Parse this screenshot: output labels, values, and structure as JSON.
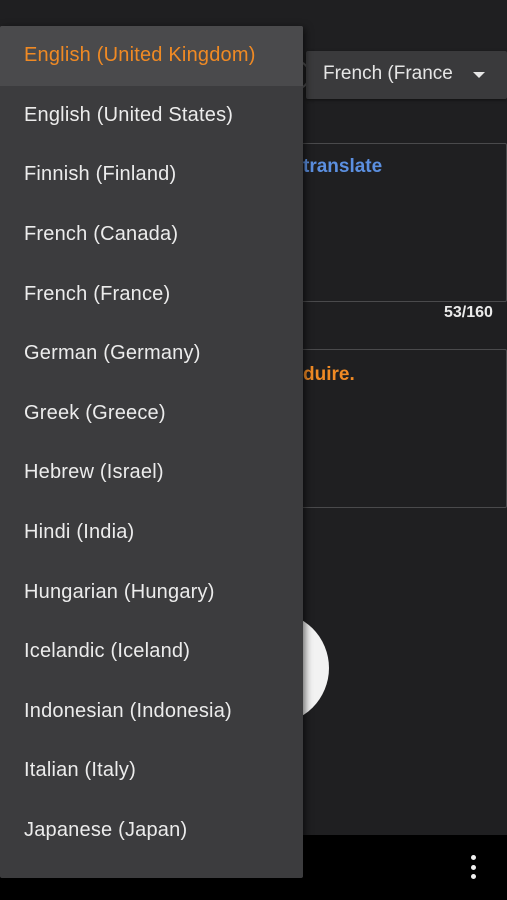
{
  "target_language": {
    "selected_label": "French (France)",
    "caret_icon": "caret-down-icon"
  },
  "input_box": {
    "text": "translate"
  },
  "output_box": {
    "text": "duire."
  },
  "char_count": "53/160",
  "bottom_bar": {
    "menu_icon": "more-vert-icon"
  },
  "dropdown": {
    "selected_index": 0,
    "items": [
      "English (United Kingdom)",
      "English (United States)",
      "Finnish (Finland)",
      "French (Canada)",
      "French (France)",
      "German (Germany)",
      "Greek (Greece)",
      "Hebrew (Israel)",
      "Hindi (India)",
      "Hungarian (Hungary)",
      "Icelandic (Iceland)",
      "Indonesian (Indonesia)",
      "Italian (Italy)",
      "Japanese (Japan)"
    ]
  },
  "colors": {
    "accent": "#f08a24",
    "link_blue": "#5b8fe0",
    "background": "#1f1f21",
    "dropdown_bg": "#3c3c3e"
  }
}
